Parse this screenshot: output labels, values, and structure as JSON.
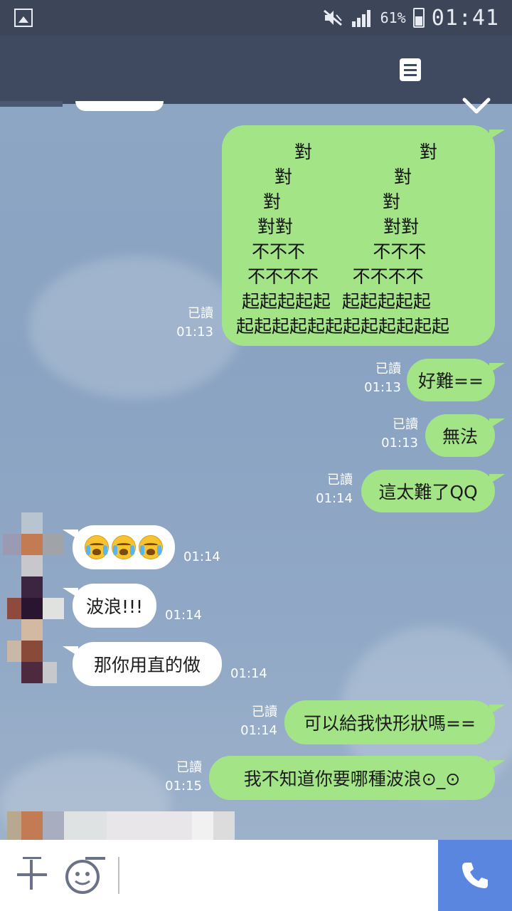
{
  "status_bar": {
    "battery_percent": "61%",
    "battery_level": 0.61,
    "time": "01:41"
  },
  "header": {
    "memo_icon": "memo-icon",
    "collapse_icon": "chevron-down-icon"
  },
  "messages": {
    "art": {
      "lines": [
        "對                   對",
        "對                  對",
        "對                  對",
        "對對                對對",
        "不不不            不不不",
        "不不不不      不不不不",
        "起起起起起  起起起起起",
        "起起起起起起起起起起起起"
      ],
      "read_label": "已讀",
      "time": "01:13"
    },
    "m1": {
      "text": "好難==",
      "read_label": "已讀",
      "time": "01:13"
    },
    "m2": {
      "text": "無法",
      "read_label": "已讀",
      "time": "01:13"
    },
    "m3": {
      "text": "這太難了QQ",
      "read_label": "已讀",
      "time": "01:14"
    },
    "r1": {
      "emoji": "crying-face",
      "count": 3,
      "time": "01:14"
    },
    "r2": {
      "text": "波浪!!!",
      "time": "01:14"
    },
    "r3": {
      "text": "那你用直的做",
      "time": "01:14"
    },
    "m4": {
      "text": "可以給我快形狀嗎==",
      "read_label": "已讀",
      "time": "01:14"
    },
    "m5": {
      "text": "我不知道你要哪種波浪⊙_⊙",
      "read_label": "已讀",
      "time": "01:15"
    }
  },
  "input_bar": {
    "placeholder": "",
    "plus_icon": "plus-icon",
    "sticker_icon": "sticker-icon",
    "call_icon": "phone-icon"
  },
  "colors": {
    "status_bar": "#3d4659",
    "header": "#3f4960",
    "sent_bubble": "#a3e487",
    "received_bubble": "#ffffff",
    "call_button": "#5b86e0"
  }
}
